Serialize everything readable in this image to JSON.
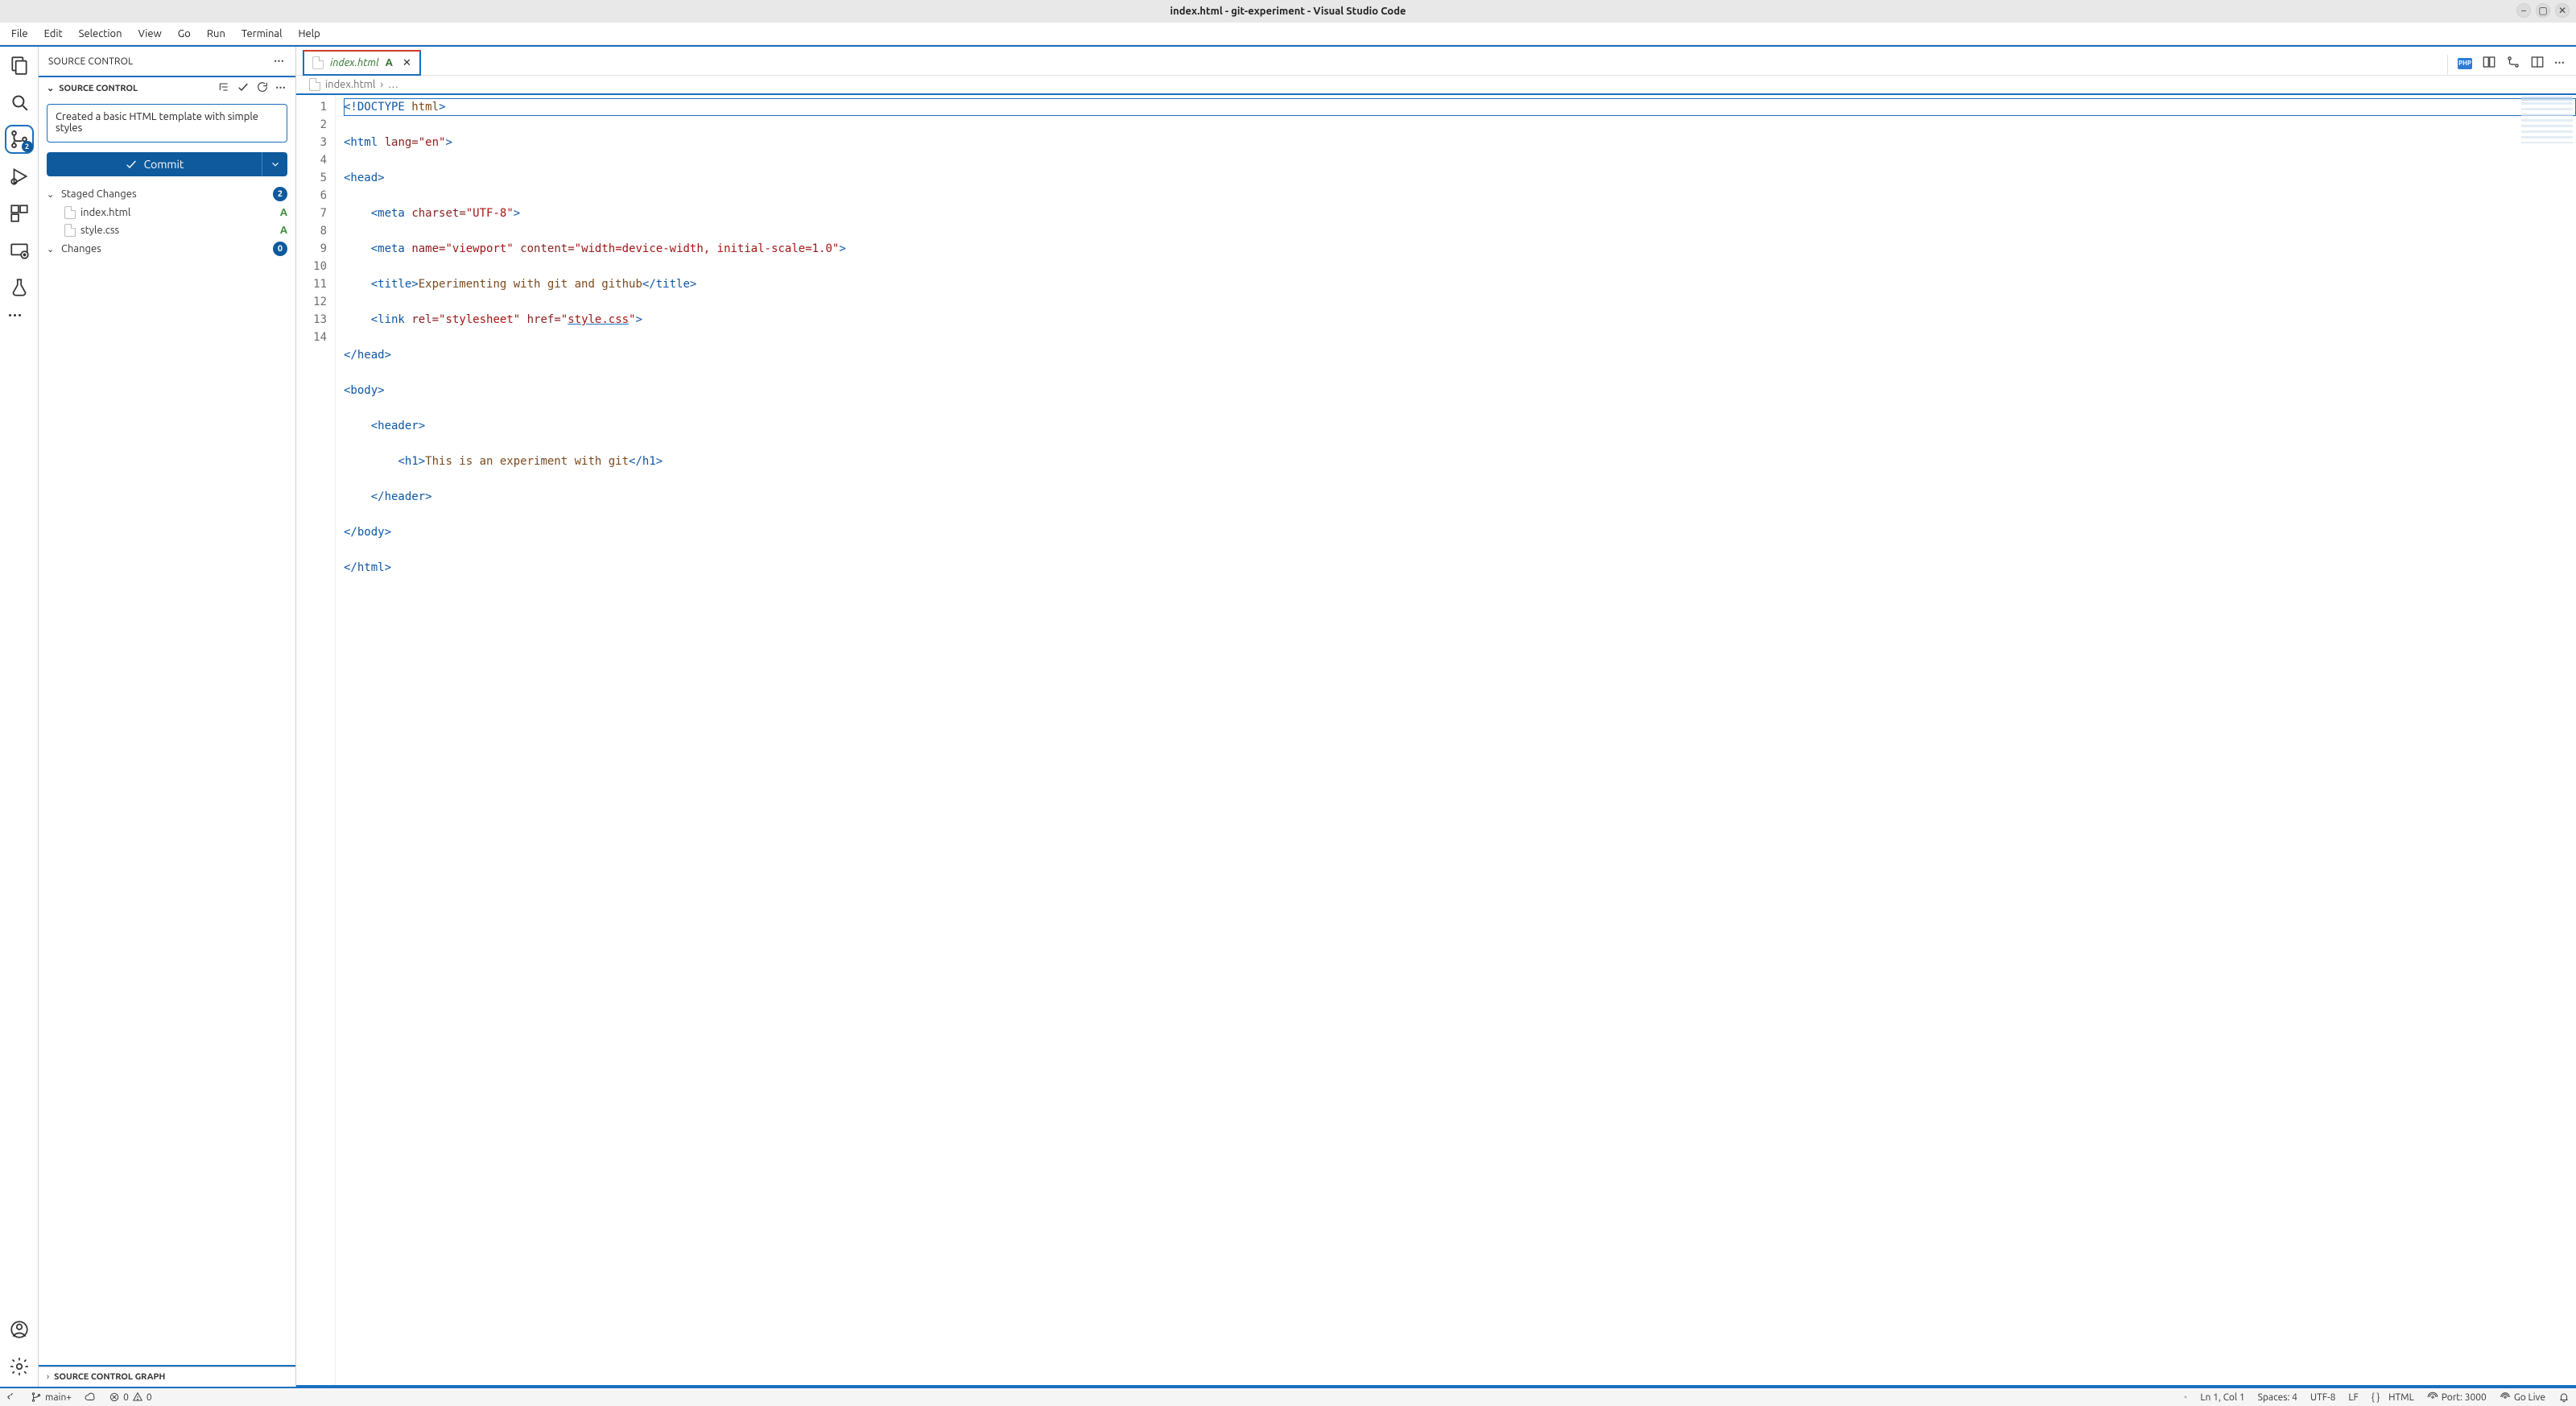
{
  "window": {
    "title": "index.html - git-experiment - Visual Studio Code"
  },
  "menu": [
    "File",
    "Edit",
    "Selection",
    "View",
    "Go",
    "Run",
    "Terminal",
    "Help"
  ],
  "activity": {
    "scm_badge": "2"
  },
  "sidepanel": {
    "title": "SOURCE CONTROL",
    "section_title": "SOURCE CONTROL",
    "commit_message": "Created a basic HTML template with simple styles",
    "commit_button": "Commit",
    "groups": [
      {
        "label": "Staged Changes",
        "count": "2",
        "expanded": true,
        "files": [
          {
            "name": "index.html",
            "status": "A"
          },
          {
            "name": "style.css",
            "status": "A"
          }
        ]
      },
      {
        "label": "Changes",
        "count": "0",
        "expanded": true,
        "files": []
      }
    ],
    "graph_title": "SOURCE CONTROL GRAPH"
  },
  "tab": {
    "label": "index.html",
    "modified_marker": "A"
  },
  "breadcrumb": {
    "file": "index.html",
    "rest": "…"
  },
  "editor_actions": {
    "php": "PHP"
  },
  "code_lines": [
    {
      "n": "1",
      "indent": 0,
      "tokens": [
        [
          "tag",
          "<!DOCTYPE"
        ],
        [
          "plain",
          " "
        ],
        [
          "txt",
          "html"
        ],
        [
          "tag",
          ">"
        ]
      ],
      "selected": true
    },
    {
      "n": "2",
      "indent": 0,
      "tokens": [
        [
          "tag",
          "<html"
        ],
        [
          "plain",
          " "
        ],
        [
          "attr",
          "lang="
        ],
        [
          "str",
          "\"en\""
        ],
        [
          "tag",
          ">"
        ]
      ]
    },
    {
      "n": "3",
      "indent": 0,
      "tokens": [
        [
          "tag",
          "<head>"
        ]
      ]
    },
    {
      "n": "4",
      "indent": 1,
      "tokens": [
        [
          "tag",
          "<meta"
        ],
        [
          "plain",
          " "
        ],
        [
          "attr",
          "charset="
        ],
        [
          "str",
          "\"UTF-8\""
        ],
        [
          "tag",
          ">"
        ]
      ]
    },
    {
      "n": "5",
      "indent": 1,
      "tokens": [
        [
          "tag",
          "<meta"
        ],
        [
          "plain",
          " "
        ],
        [
          "attr",
          "name="
        ],
        [
          "str",
          "\"viewport\""
        ],
        [
          "plain",
          " "
        ],
        [
          "attr",
          "content="
        ],
        [
          "str",
          "\"width=device-width, initial-scale=1.0\""
        ],
        [
          "tag",
          ">"
        ]
      ]
    },
    {
      "n": "6",
      "indent": 1,
      "tokens": [
        [
          "tag",
          "<title>"
        ],
        [
          "txt",
          "Experimenting with git and github"
        ],
        [
          "tag",
          "</title>"
        ]
      ]
    },
    {
      "n": "7",
      "indent": 1,
      "tokens": [
        [
          "tag",
          "<link"
        ],
        [
          "plain",
          " "
        ],
        [
          "attr",
          "rel="
        ],
        [
          "str",
          "\"stylesheet\""
        ],
        [
          "plain",
          " "
        ],
        [
          "attr",
          "href="
        ],
        [
          "str",
          "\""
        ],
        [
          "str_u",
          "style.css"
        ],
        [
          "str",
          "\""
        ],
        [
          "tag",
          ">"
        ]
      ]
    },
    {
      "n": "8",
      "indent": 0,
      "tokens": [
        [
          "tag",
          "</head>"
        ]
      ]
    },
    {
      "n": "9",
      "indent": 0,
      "tokens": [
        [
          "tag",
          "<body>"
        ]
      ]
    },
    {
      "n": "10",
      "indent": 1,
      "tokens": [
        [
          "tag",
          "<header>"
        ]
      ]
    },
    {
      "n": "11",
      "indent": 2,
      "tokens": [
        [
          "tag",
          "<h1>"
        ],
        [
          "txt",
          "This is an experiment with git"
        ],
        [
          "tag",
          "</h1>"
        ]
      ]
    },
    {
      "n": "12",
      "indent": 1,
      "tokens": [
        [
          "tag",
          "</header>"
        ]
      ]
    },
    {
      "n": "13",
      "indent": 0,
      "tokens": [
        [
          "tag",
          "</body>"
        ]
      ]
    },
    {
      "n": "14",
      "indent": 0,
      "tokens": [
        [
          "tag",
          "</html>"
        ]
      ]
    }
  ],
  "status": {
    "branch": "main+",
    "errors": "0",
    "warnings": "0",
    "cursor": "Ln 1, Col 1",
    "spaces": "Spaces: 4",
    "encoding": "UTF-8",
    "eol": "LF",
    "lang": "HTML",
    "port": "Port: 3000",
    "golive": "Go Live"
  }
}
